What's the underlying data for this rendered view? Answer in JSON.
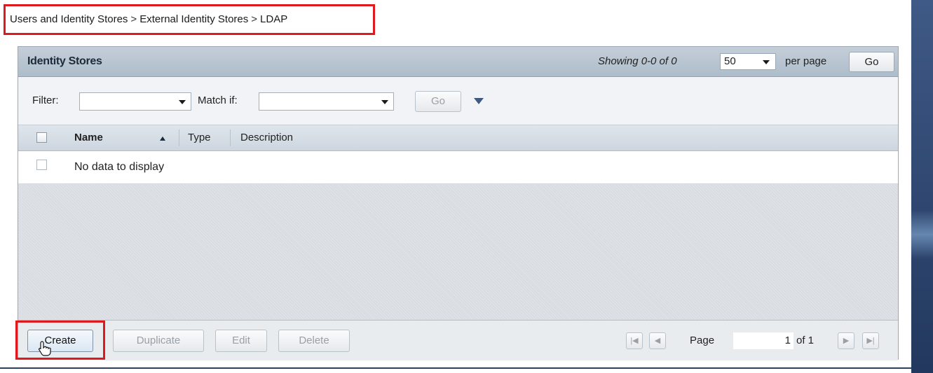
{
  "breadcrumb": {
    "items": [
      "Users and Identity Stores",
      "External Identity Stores",
      "LDAP"
    ],
    "separator": ">"
  },
  "panel": {
    "title": "Identity Stores",
    "showing": "Showing 0-0 of 0",
    "per_page_value": "50",
    "per_page_label": "per page",
    "go_label": "Go"
  },
  "filter": {
    "filter_label": "Filter:",
    "filter_value": "",
    "match_label": "Match if:",
    "match_value": "",
    "go_label": "Go"
  },
  "table": {
    "columns": [
      "Name",
      "Type",
      "Description"
    ],
    "sorted_column": "Name",
    "sort_direction": "ascending",
    "empty_message": "No data to display"
  },
  "toolbar": {
    "create_label": "Create",
    "duplicate_label": "Duplicate",
    "edit_label": "Edit",
    "delete_label": "Delete",
    "page_label": "Page",
    "page_value": "1",
    "of_label": "of 1"
  },
  "colors": {
    "highlight": "#e0191f",
    "panel_header": "#b8c5d2",
    "right_strip": "#2f4770"
  },
  "icons": {
    "per_page_dropdown": "chevron-down-icon",
    "expand_filter": "triangle-down-icon",
    "sort": "sort-up-icon",
    "cursor": "hand-cursor-icon"
  }
}
